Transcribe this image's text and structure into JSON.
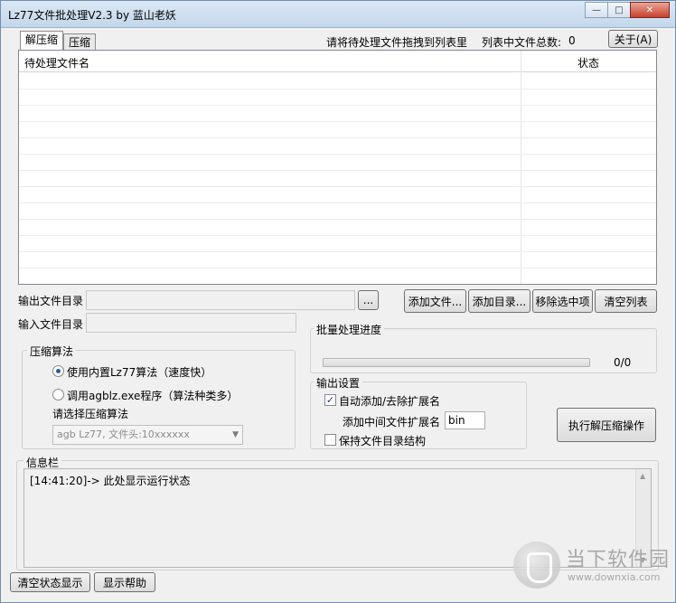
{
  "window": {
    "title": "Lz77文件批处理V2.3 by 蓝山老妖",
    "minimize_glyph": "—",
    "maximize_glyph": "□",
    "close_glyph": "✕"
  },
  "tabs": [
    {
      "label": "解压缩",
      "active": true
    },
    {
      "label": "压缩",
      "active": false
    }
  ],
  "top": {
    "drag_hint": "请将待处理文件拖拽到列表里",
    "count_label": "列表中文件总数:",
    "count_value": "0",
    "about_button": "关于(A)"
  },
  "file_list": {
    "columns": [
      "待处理文件名",
      "状态"
    ],
    "rows": []
  },
  "paths": {
    "output_dir_label": "输出文件目录",
    "output_dir_value": "",
    "browse_button": "...",
    "input_dir_label": "输入文件目录",
    "input_dir_value": ""
  },
  "list_buttons": {
    "add_files": "添加文件...",
    "add_dir": "添加目录...",
    "remove_selected": "移除选中项",
    "clear_list": "清空列表"
  },
  "compression": {
    "group_title": "压缩算法",
    "option_builtin": "使用内置Lz77算法（速度快）",
    "option_external": "调用agblz.exe程序（算法种类多）",
    "selected": "builtin",
    "select_label": "请选择压缩算法",
    "algorithm_value": "agb Lz77, 文件头:10xxxxxx"
  },
  "progress": {
    "group_title": "批量处理进度",
    "text": "0/0",
    "fraction": 0
  },
  "output_settings": {
    "group_title": "输出设置",
    "auto_ext_label": "自动添加/去除扩展名",
    "auto_ext_checked": true,
    "mid_ext_label": "添加中间文件扩展名",
    "mid_ext_value": "bin",
    "keep_structure_label": "保持文件目录结构",
    "keep_structure_checked": false
  },
  "execute_button": "执行解压缩操作",
  "info": {
    "group_title": "信息栏",
    "lines": [
      "[14:41:20]-> 此处显示运行状态"
    ]
  },
  "bottom_buttons": {
    "clear_status": "清空状态显示",
    "show_help": "显示帮助"
  },
  "watermark": {
    "text": "当下软件园",
    "url": "www.downxia.com"
  }
}
